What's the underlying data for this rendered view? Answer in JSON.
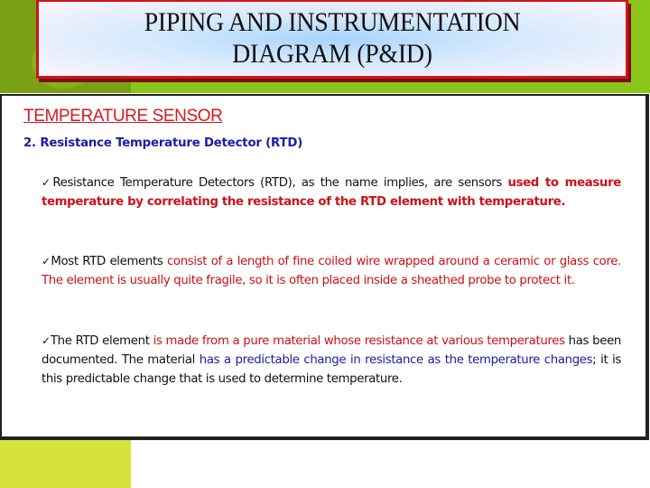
{
  "slide": {
    "title_line1": "PIPING AND INSTRUMENTATION",
    "title_line2": "DIAGRAM (P&ID)",
    "heading": "TEMPERATURE SENSOR",
    "subheading": "2. Resistance Temperature Detector (RTD)",
    "bullet_icon": "✓",
    "bullets": [
      {
        "segments": [
          {
            "text": "Resistance Temperature Detectors (RTD), as the name implies, are sensors ",
            "color": "black"
          },
          {
            "text": "used to measure temperature by correlating the resistance of the RTD element with temperature.",
            "color": "red"
          }
        ]
      },
      {
        "segments": [
          {
            "text": "Most RTD elements ",
            "color": "black"
          },
          {
            "text": "consist of a length of fine coiled wire wrapped around a ceramic or glass core. The element is usually quite fragile, so it is often placed inside a sheathed probe to protect it.",
            "color": "red"
          }
        ]
      },
      {
        "segments": [
          {
            "text": "The RTD element ",
            "color": "black"
          },
          {
            "text": "is made from a pure material whose resistance at various temperatures",
            "color": "red"
          },
          {
            "text": " has been documented. The material ",
            "color": "black"
          },
          {
            "text": "has a predictable change in resistance as the temperature changes",
            "color": "blue"
          },
          {
            "text": "; it is this predictable change that is used to determine temperature.",
            "color": "black"
          }
        ]
      }
    ]
  },
  "colors": {
    "header_green": "#8cc51a",
    "header_dark_green": "#7aa114",
    "title_border": "#d4121a",
    "heading_red": "#d61a22",
    "subheading_blue": "#1b1ba8",
    "text_red": "#cc1118",
    "accent_yellow_green": "#d5e33a"
  }
}
